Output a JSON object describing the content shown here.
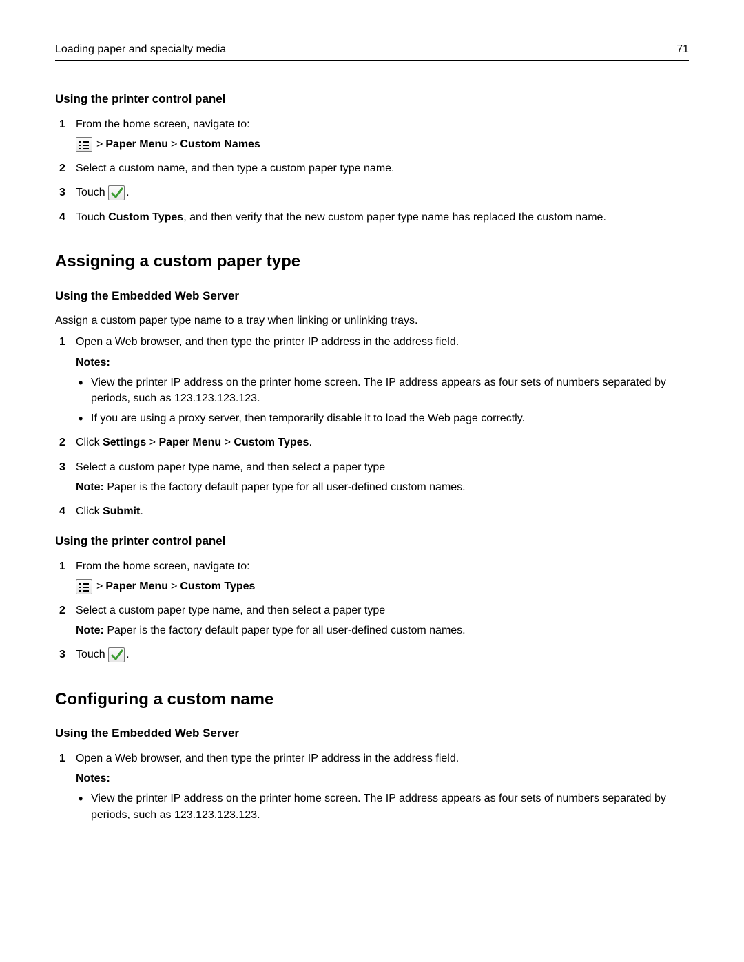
{
  "header": {
    "section": "Loading paper and specialty media",
    "page": "71"
  },
  "section1": {
    "heading": "Using the printer control panel",
    "step1": "From the home screen, navigate to:",
    "navpath_sep": " > ",
    "navpath_b1": "Paper Menu",
    "navpath_sep2": " > ",
    "navpath_b2": "Custom Names",
    "step2": "Select a custom name, and then type a custom paper type name.",
    "step3_pre": "Touch ",
    "step3_post": ".",
    "step4_pre": "Touch ",
    "step4_bold": "Custom Types",
    "step4_post": ", and then verify that the new custom paper type name has replaced the custom name."
  },
  "section2": {
    "title": "Assigning a custom paper type",
    "sub1": {
      "heading": "Using the Embedded Web Server",
      "intro": "Assign a custom paper type name to a tray when linking or unlinking trays.",
      "step1": "Open a Web browser, and then type the printer IP address in the address field.",
      "notes_label": "Notes:",
      "bullet1": "View the printer IP address on the printer home screen. The IP address appears as four sets of numbers separated by periods, such as 123.123.123.123.",
      "bullet2": "If you are using a proxy server, then temporarily disable it to load the Web page correctly.",
      "step2_pre": "Click ",
      "step2_b1": "Settings",
      "step2_s1": " > ",
      "step2_b2": "Paper Menu",
      "step2_s2": " > ",
      "step2_b3": "Custom Types",
      "step2_post": ".",
      "step3": "Select a custom paper type name, and then select a paper type",
      "step3_note_b": "Note:",
      "step3_note": " Paper is the factory default paper type for all user‑defined custom names.",
      "step4_pre": "Click ",
      "step4_b": "Submit",
      "step4_post": "."
    },
    "sub2": {
      "heading": "Using the printer control panel",
      "step1": "From the home screen, navigate to:",
      "nav_sep1": " > ",
      "nav_b1": "Paper Menu",
      "nav_sep2": " > ",
      "nav_b2": "Custom Types",
      "step2": "Select a custom paper type name, and then select a paper type",
      "step2_note_b": "Note:",
      "step2_note": " Paper is the factory default paper type for all user‑defined custom names.",
      "step3_pre": "Touch ",
      "step3_post": "."
    }
  },
  "section3": {
    "title": "Configuring a custom name",
    "sub1": {
      "heading": "Using the Embedded Web Server",
      "step1": "Open a Web browser, and then type the printer IP address in the address field.",
      "notes_label": "Notes:",
      "bullet1": "View the printer IP address on the printer home screen. The IP address appears as four sets of numbers separated by periods, such as 123.123.123.123."
    }
  },
  "nums": {
    "n1": "1",
    "n2": "2",
    "n3": "3",
    "n4": "4"
  }
}
